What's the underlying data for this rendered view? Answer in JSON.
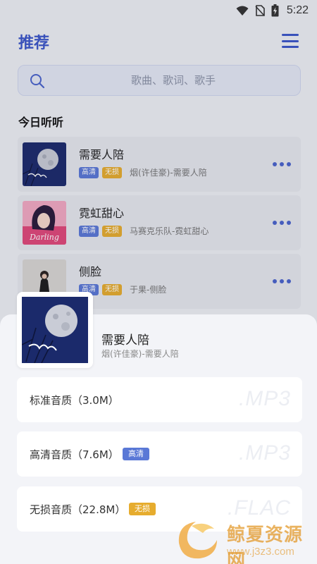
{
  "status_bar": {
    "time": "5:22"
  },
  "header": {
    "title": "推荐"
  },
  "search": {
    "placeholder": "歌曲、歌词、歌手"
  },
  "section": {
    "title": "今日听听"
  },
  "songs": [
    {
      "title": "需要人陪",
      "badges": [
        "高清",
        "无损"
      ],
      "artist": "烟(许佳豪)-需要人陪",
      "cover_text": ""
    },
    {
      "title": "霓虹甜心",
      "badges": [
        "高清",
        "无损"
      ],
      "artist": "马赛克乐队-霓虹甜心",
      "cover_text": "Darling"
    },
    {
      "title": "侧脸",
      "badges": [
        "高清",
        "无损"
      ],
      "artist": "于果-侧脸",
      "cover_text": ""
    }
  ],
  "sheet": {
    "title": "需要人陪",
    "artist": "烟(许佳豪)-需要人陪",
    "options": [
      {
        "label": "标准音质（3.0M）",
        "badge": "",
        "format": ".MP3"
      },
      {
        "label": "高清音质（7.6M）",
        "badge": "高清",
        "format": ".MP3"
      },
      {
        "label": "无损音质（22.8M）",
        "badge": "无损",
        "format": ".FLAC"
      }
    ]
  },
  "watermark": {
    "text": "鲸夏资源网",
    "url": "www.j3z3.com"
  },
  "colors": {
    "accent": "#3b56c9",
    "badge_hq": "#5a78d6",
    "badge_lossless": "#e6ac2e"
  }
}
